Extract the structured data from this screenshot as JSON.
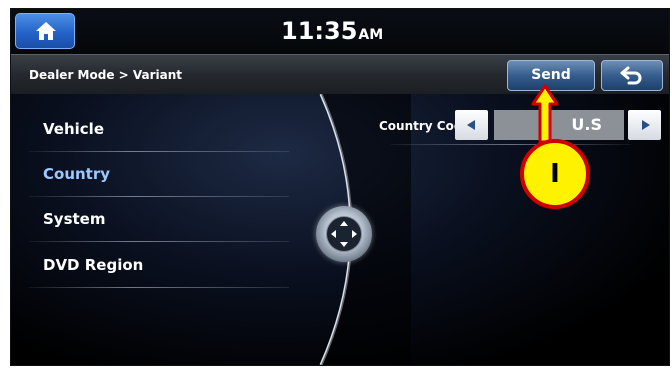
{
  "status_bar": {
    "time": "11:35",
    "ampm": "AM",
    "home_icon": "home-icon"
  },
  "title_bar": {
    "breadcrumb": "Dealer Mode > Variant",
    "send_label": "Send",
    "back_icon": "back-arrow-icon"
  },
  "menu": {
    "items": [
      {
        "label": "Vehicle",
        "active": false
      },
      {
        "label": "Country",
        "active": true
      },
      {
        "label": "System",
        "active": false
      },
      {
        "label": "DVD Region",
        "active": false
      }
    ]
  },
  "country_code": {
    "label": "Country Code",
    "value": "U.S"
  },
  "annotation": {
    "label": "I",
    "colors": {
      "fill": "#fff200",
      "stroke": "#d00000"
    }
  },
  "colors": {
    "accent_blue": "#2463c8",
    "active_text": "#9cc8ff"
  }
}
